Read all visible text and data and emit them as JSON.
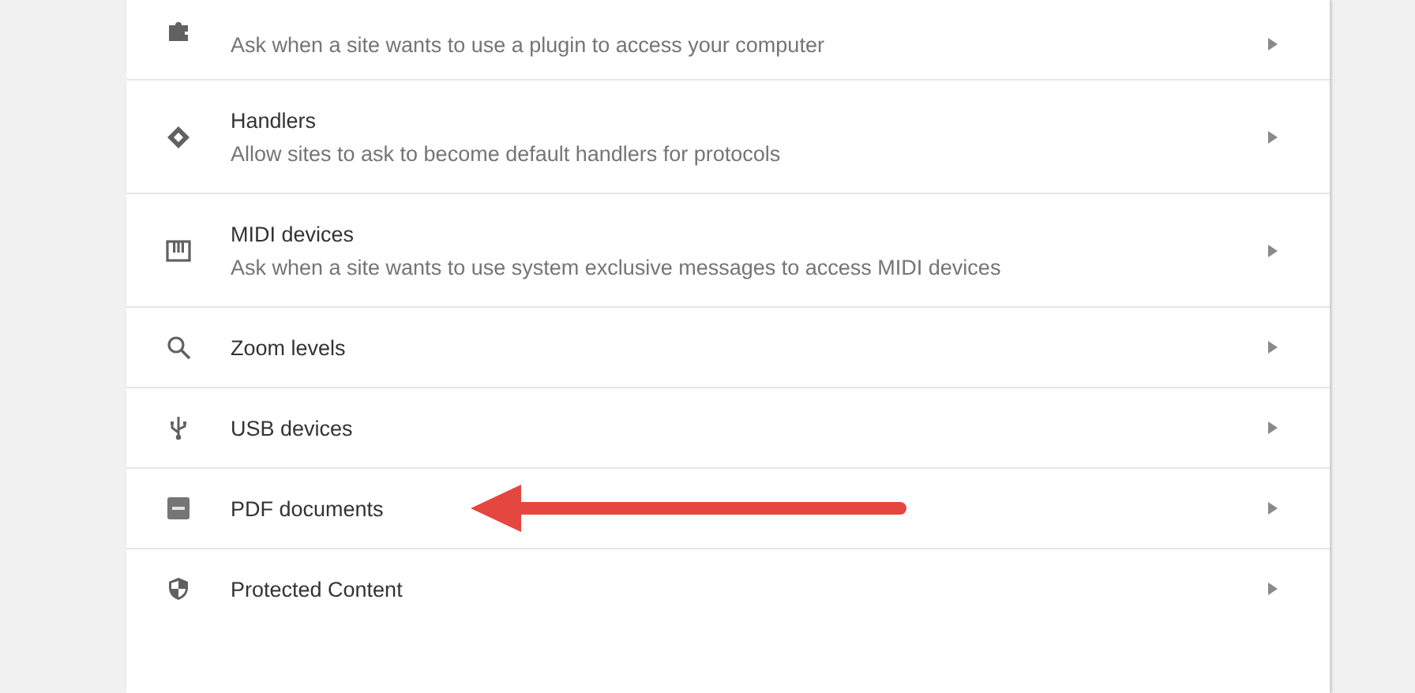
{
  "settings_list": [
    {
      "description": "Ask when a site wants to use a plugin to access your computer",
      "annotated": false
    },
    {
      "title": "Handlers",
      "description": "Allow sites to ask to become default handlers for protocols",
      "annotated": false
    },
    {
      "title": "MIDI devices",
      "description": "Ask when a site wants to use system exclusive messages to access MIDI devices",
      "annotated": false
    },
    {
      "title": "Zoom levels",
      "annotated": false
    },
    {
      "title": "USB devices",
      "annotated": false
    },
    {
      "title": "PDF documents",
      "annotated": true
    },
    {
      "title": "Protected Content",
      "annotated": false
    }
  ]
}
